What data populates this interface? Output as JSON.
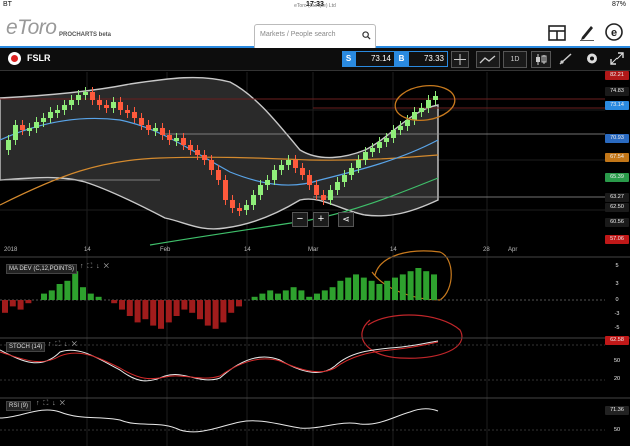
{
  "status": {
    "carrier": "BT",
    "time": "17:33",
    "battery": "87%"
  },
  "brand": {
    "logo": "eToro",
    "subtitle": "PROCHARTS beta"
  },
  "search": {
    "label": "eToro (Europe) Ltd",
    "placeholder": "Markets / People search"
  },
  "instrument": {
    "symbol": "FSLR",
    "sell_tag": "S",
    "sell_price": "73.14",
    "buy_tag": "B",
    "buy_price": "73.33",
    "timeframe": "1D"
  },
  "price_axis": [
    "82.21",
    "74.83",
    "73.14",
    "70.93",
    "67.54",
    "65.39",
    "63.27",
    "62.50",
    "60.56",
    "57.06"
  ],
  "time_axis": [
    "2018",
    "14",
    "Feb",
    "14",
    "Mar",
    "14",
    "28",
    "Apr"
  ],
  "panels": {
    "madev": {
      "label": "MA DEV (C,12,POINTS)",
      "axis": [
        "5",
        "3",
        "0",
        "-3",
        "-5"
      ]
    },
    "stoch": {
      "label": "STOCH (14)",
      "axis": [
        "80",
        "62.58",
        "50",
        "20"
      ]
    },
    "rsi": {
      "label": "RSI (9)",
      "axis": [
        "71.36",
        "50"
      ]
    }
  },
  "colors": {
    "accent": "#2a8ae0",
    "up": "#90ee7a",
    "down": "#ff5a3c",
    "bands": "#c8c8c8"
  },
  "icons": [
    "search-icon",
    "layout-icon",
    "pencil-icon",
    "etoro-icon",
    "crosshair-icon",
    "line-chart-icon",
    "candle-icon",
    "draw-icon",
    "settings-icon",
    "fullscreen-icon",
    "zoom-out-icon",
    "zoom-in-icon",
    "share-icon"
  ]
}
